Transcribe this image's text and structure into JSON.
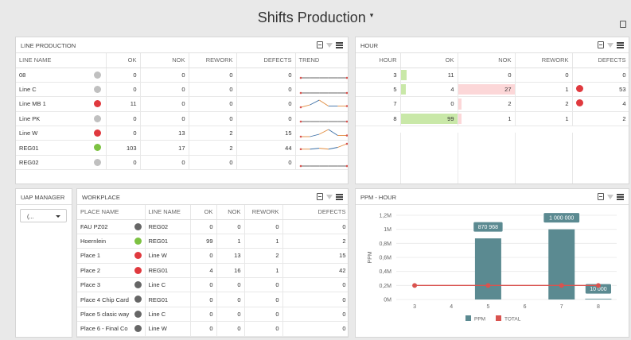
{
  "header": {
    "title": "Shifts Production",
    "caret": "▾"
  },
  "line_production": {
    "title": "LINE PRODUCTION",
    "columns": [
      "LINE NAME",
      "OK",
      "NOK",
      "REWORK",
      "DEFECTS",
      "TREND"
    ],
    "rows": [
      {
        "name": "08",
        "status": "#c0c0c0",
        "ok": "0",
        "nok": "0",
        "rework": "0",
        "defects": "0",
        "trend": [
          0,
          0,
          0,
          0,
          0,
          0
        ]
      },
      {
        "name": "Line C",
        "status": "#c0c0c0",
        "ok": "0",
        "nok": "0",
        "rework": "0",
        "defects": "0",
        "trend": [
          0,
          0,
          0,
          0,
          0,
          0
        ]
      },
      {
        "name": "Line MB 1",
        "status": "#e0393e",
        "ok": "11",
        "nok": "0",
        "rework": "0",
        "defects": "0",
        "trend": [
          0,
          2,
          6,
          1,
          1,
          1
        ]
      },
      {
        "name": "Line PK",
        "status": "#c0c0c0",
        "ok": "0",
        "nok": "0",
        "rework": "0",
        "defects": "0",
        "trend": [
          0,
          0,
          0,
          0,
          0,
          0
        ]
      },
      {
        "name": "Line W",
        "status": "#e0393e",
        "ok": "0",
        "nok": "13",
        "rework": "2",
        "defects": "15",
        "trend": [
          0,
          0,
          2,
          6,
          1,
          1
        ]
      },
      {
        "name": "REG01",
        "status": "#7dc242",
        "ok": "103",
        "nok": "17",
        "rework": "2",
        "defects": "44",
        "trend": [
          2,
          2,
          3,
          2,
          4,
          8
        ]
      },
      {
        "name": "REG02",
        "status": "#c0c0c0",
        "ok": "0",
        "nok": "0",
        "rework": "0",
        "defects": "0",
        "trend": [
          0,
          0,
          0,
          0,
          0,
          0
        ]
      }
    ]
  },
  "hour_panel": {
    "title": "HOUR",
    "columns": [
      "HOUR",
      "OK",
      "NOK",
      "REWORK",
      "DEFECTS"
    ],
    "rows": [
      {
        "hour": "3",
        "ok": "11",
        "nok": "0",
        "rework": "0",
        "defects": "0",
        "ok_level": 0.11,
        "nok_level": 0,
        "defects_dot": false
      },
      {
        "hour": "5",
        "ok": "4",
        "nok": "27",
        "rework": "1",
        "defects": "53",
        "ok_level": 0.04,
        "nok_level": 1.0,
        "defects_dot": true
      },
      {
        "hour": "7",
        "ok": "0",
        "nok": "2",
        "rework": "2",
        "defects": "4",
        "ok_level": 0,
        "nok_level": 0.07,
        "defects_dot": true
      },
      {
        "hour": "8",
        "ok": "99",
        "nok": "1",
        "rework": "1",
        "defects": "2",
        "ok_level": 1.0,
        "nok_level": 0.04,
        "defects_dot": false
      }
    ]
  },
  "uap_manager": {
    "title": "UAP MANAGER",
    "selected": "(..."
  },
  "workplace": {
    "title": "WORKPLACE",
    "columns": [
      "PLACE NAME",
      "LINE NAME",
      "OK",
      "NOK",
      "REWORK",
      "DEFECTS"
    ],
    "rows": [
      {
        "place": "FAU PZ02",
        "status": "#666666",
        "line": "REG02",
        "ok": "0",
        "nok": "0",
        "rework": "0",
        "defects": "0"
      },
      {
        "place": "Hoernlein",
        "status": "#7dc242",
        "line": "REG01",
        "ok": "99",
        "nok": "1",
        "rework": "1",
        "defects": "2"
      },
      {
        "place": "Place 1",
        "status": "#e0393e",
        "line": "Line W",
        "ok": "0",
        "nok": "13",
        "rework": "2",
        "defects": "15"
      },
      {
        "place": "Place 2",
        "status": "#e0393e",
        "line": "REG01",
        "ok": "4",
        "nok": "16",
        "rework": "1",
        "defects": "42"
      },
      {
        "place": "Place 3",
        "status": "#666666",
        "line": "Line C",
        "ok": "0",
        "nok": "0",
        "rework": "0",
        "defects": "0"
      },
      {
        "place": "Place 4 Chip Card",
        "status": "#666666",
        "line": "REG01",
        "ok": "0",
        "nok": "0",
        "rework": "0",
        "defects": "0"
      },
      {
        "place": "Place 5 clasic way",
        "status": "#666666",
        "line": "Line C",
        "ok": "0",
        "nok": "0",
        "rework": "0",
        "defects": "0"
      },
      {
        "place": "Place 6 - Final Co",
        "status": "#666666",
        "line": "Line W",
        "ok": "0",
        "nok": "0",
        "rework": "0",
        "defects": "0"
      }
    ]
  },
  "ppm_panel": {
    "title": "PPM - HOUR"
  },
  "chart_data": {
    "type": "bar",
    "categories": [
      "3",
      "4",
      "5",
      "6",
      "7",
      "8"
    ],
    "series": [
      {
        "name": "PPM",
        "type": "bar",
        "color": "#5b8a91",
        "values": [
          0,
          0,
          870968,
          0,
          1000000,
          10000
        ],
        "labels": [
          "",
          "",
          "870 968",
          "",
          "1 000 000",
          "10 000"
        ]
      },
      {
        "name": "TOTAL",
        "type": "line",
        "color": "#d9534f",
        "values": [
          200000,
          null,
          200000,
          null,
          200000,
          200000
        ]
      }
    ],
    "ylabel": "PPM",
    "yticks": [
      "0M",
      "0,2M",
      "0,4M",
      "0,6M",
      "0,8M",
      "1M",
      "1,2M"
    ],
    "ylim": [
      0,
      1200000
    ],
    "legend": "bottom",
    "grid": true
  }
}
